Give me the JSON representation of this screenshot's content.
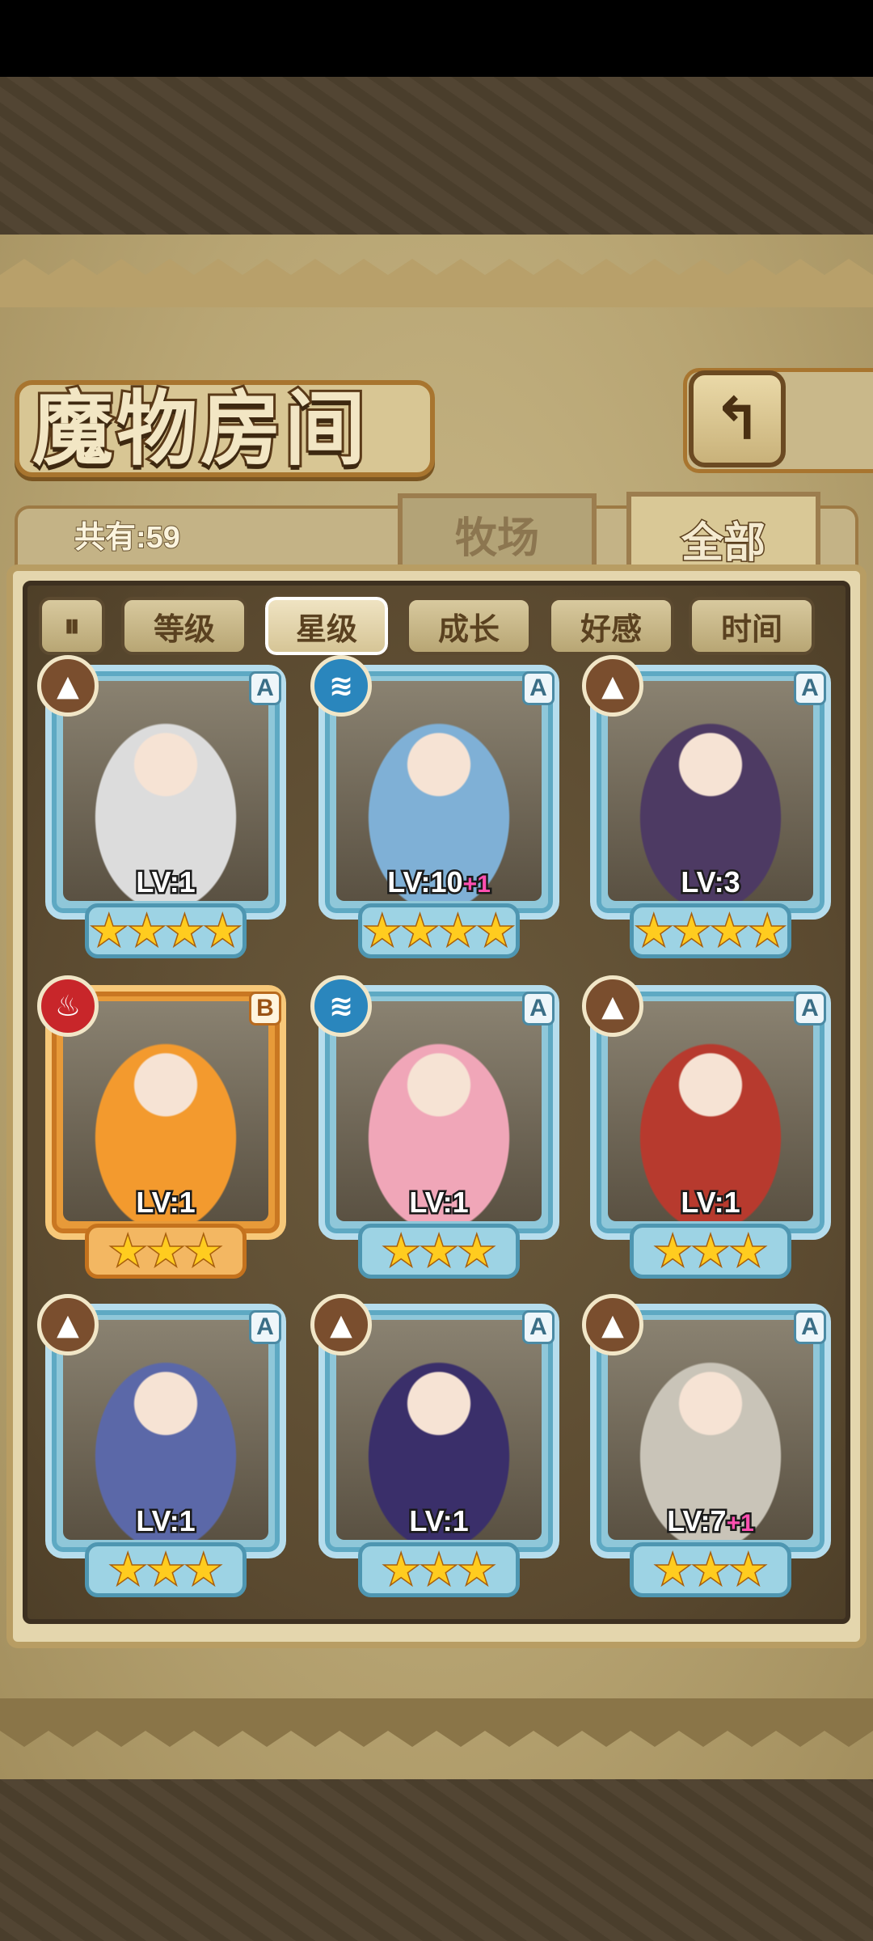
{
  "header": {
    "title": "魔物房间",
    "back_icon": "↰"
  },
  "summary": {
    "count_label": "共有:59"
  },
  "tabs": [
    {
      "label": "牧场",
      "active": false
    },
    {
      "label": "全部",
      "active": true
    }
  ],
  "filters": {
    "toggle_icon": "⏸",
    "buttons": [
      {
        "label": "等级",
        "active": false
      },
      {
        "label": "星级",
        "active": true
      },
      {
        "label": "成长",
        "active": false
      },
      {
        "label": "好感",
        "active": false
      },
      {
        "label": "时间",
        "active": false
      }
    ]
  },
  "monsters": [
    {
      "element": "earth",
      "element_icon": "▲",
      "rank": "A",
      "level": "LV:1",
      "bonus": "",
      "stars": 4,
      "color": "#dcdcdc"
    },
    {
      "element": "water",
      "element_icon": "≋",
      "rank": "A",
      "level": "LV:10",
      "bonus": "+1",
      "stars": 4,
      "color": "#7fb0d6"
    },
    {
      "element": "earth",
      "element_icon": "▲",
      "rank": "A",
      "level": "LV:3",
      "bonus": "",
      "stars": 4,
      "color": "#4d3a63"
    },
    {
      "element": "fire",
      "element_icon": "♨",
      "rank": "B",
      "level": "LV:1",
      "bonus": "",
      "stars": 3,
      "color": "#f39a2e"
    },
    {
      "element": "water",
      "element_icon": "≋",
      "rank": "A",
      "level": "LV:1",
      "bonus": "",
      "stars": 3,
      "color": "#f0a6b8"
    },
    {
      "element": "earth",
      "element_icon": "▲",
      "rank": "A",
      "level": "LV:1",
      "bonus": "",
      "stars": 3,
      "color": "#b73a2e"
    },
    {
      "element": "earth",
      "element_icon": "▲",
      "rank": "A",
      "level": "LV:1",
      "bonus": "",
      "stars": 3,
      "color": "#5b68a8"
    },
    {
      "element": "earth",
      "element_icon": "▲",
      "rank": "A",
      "level": "LV:1",
      "bonus": "",
      "stars": 3,
      "color": "#3a2f6a"
    },
    {
      "element": "earth",
      "element_icon": "▲",
      "rank": "A",
      "level": "LV:7",
      "bonus": "+1",
      "stars": 3,
      "color": "#c9c4b8"
    }
  ]
}
